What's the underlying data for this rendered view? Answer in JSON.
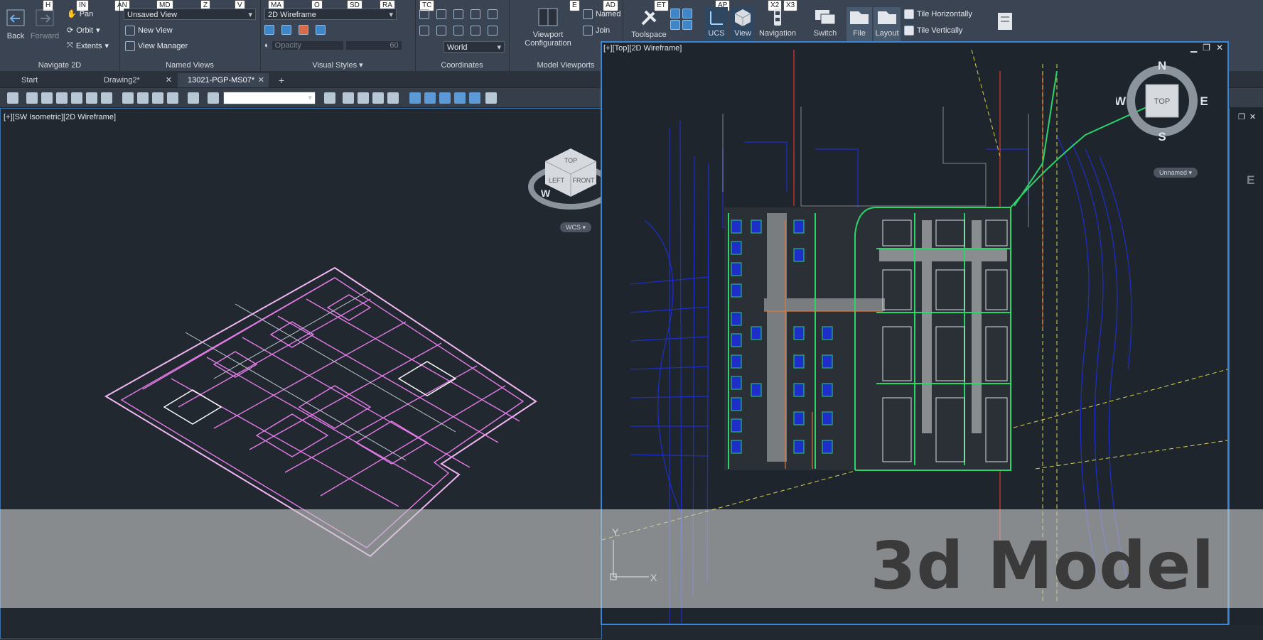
{
  "ribbon": {
    "keys": [
      "H",
      "IN",
      "AN",
      "MD",
      "Z",
      "V",
      "MA",
      "O",
      "SD",
      "RA",
      "TC",
      "E",
      "AD",
      "ET",
      "AP",
      "X2",
      "X3"
    ],
    "navigate": {
      "back": "Back",
      "forward": "Forward",
      "pan": "Pan",
      "orbit": "Orbit",
      "extents": "Extents",
      "title": "Navigate 2D"
    },
    "named_views": {
      "current": "Unsaved View",
      "new_view": "New View",
      "manager": "View Manager",
      "title": "Named Views"
    },
    "visual_styles": {
      "current": "2D Wireframe",
      "opacity_label": "Opacity",
      "opacity_value": "60",
      "title": "Visual Styles"
    },
    "coordinates": {
      "ucs": "World",
      "title": "Coordinates"
    },
    "model_viewports": {
      "config_line1": "Viewport",
      "config_line2": "Configuration",
      "named": "Named",
      "join": "Join",
      "title": "Model Viewports"
    },
    "right": {
      "toolspace": "Toolspace",
      "ucs": "UCS",
      "view": "View",
      "navigation": "Navigation",
      "switch": "Switch",
      "file": "File",
      "layout": "Layout",
      "tile_h": "Tile Horizontally",
      "tile_v": "Tile Vertically"
    }
  },
  "tabs": [
    {
      "label": "Start"
    },
    {
      "label": "Drawing2*"
    },
    {
      "label": "13021-PGP-MS07*"
    }
  ],
  "viewports": {
    "left_label": "[+][SW Isometric][2D Wireframe]",
    "right_label": "[+][Top][2D Wireframe]",
    "cube_top": "TOP",
    "cube_left": "LEFT",
    "cube_front": "FRONT",
    "wcs": "WCS",
    "compass": {
      "n": "N",
      "s": "S",
      "e": "E",
      "w": "W",
      "face": "TOP"
    },
    "unnamed": "Unnamed",
    "axis_x": "X",
    "axis_y": "Y",
    "left_compass_w": "W",
    "far_e": "E"
  },
  "banner": {
    "text": "3d Model"
  },
  "colors": {
    "ribbon": "#3b4453",
    "accent": "#3a86d6",
    "isometric": "#e47be8",
    "plan_green": "#2cd46a",
    "plan_blue": "#1d2ec9"
  }
}
